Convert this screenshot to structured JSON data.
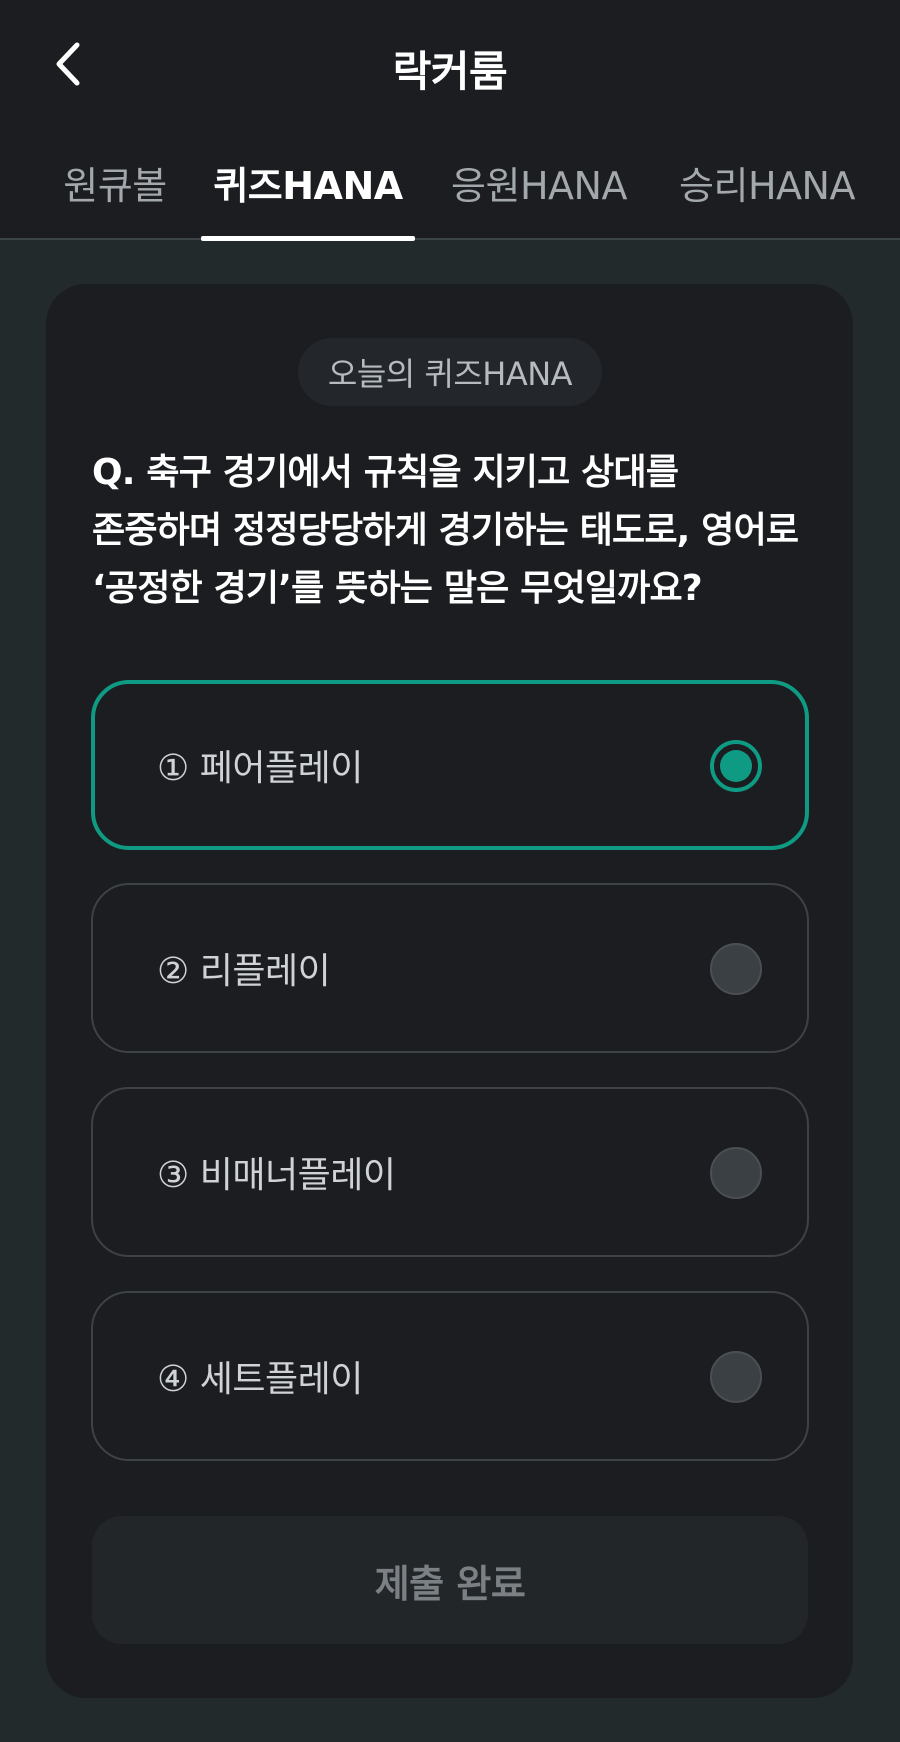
{
  "header": {
    "title": "락커룸",
    "back_icon": "chevron-left-icon"
  },
  "tabs": [
    {
      "label": "원큐볼",
      "active": false
    },
    {
      "label": "퀴즈HANA",
      "active": true
    },
    {
      "label": "응원HANA",
      "active": false
    },
    {
      "label": "승리HANA",
      "active": false
    }
  ],
  "quiz": {
    "badge": "오늘의 퀴즈HANA",
    "question_lines": [
      "Q. 축구 경기에서 규칙을 지키고 상대를",
      "존중하며 정정당당하게 경기하는 태도로, 영어로",
      "‘공정한 경기’를 뜻하는 말은 무엇일까요?"
    ],
    "options": [
      {
        "label": "① 페어플레이",
        "selected": true
      },
      {
        "label": "② 리플레이",
        "selected": false
      },
      {
        "label": "③ 비매너플레이",
        "selected": false
      },
      {
        "label": "④ 세트플레이",
        "selected": false
      }
    ],
    "submit_label": "제출 완료"
  },
  "colors": {
    "accent": "#0f9b83",
    "background": "#222a2c",
    "card": "#1b1d20",
    "header": "#1b1d20"
  }
}
